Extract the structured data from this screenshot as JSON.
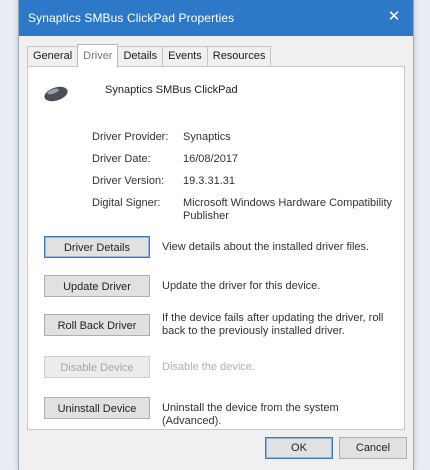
{
  "window": {
    "title": "Synaptics SMBus ClickPad Properties",
    "close_glyph": "✕",
    "titlebar_color": "#2d79c7"
  },
  "tabs": [
    {
      "label": "General"
    },
    {
      "label": "Driver",
      "active": true
    },
    {
      "label": "Details"
    },
    {
      "label": "Events"
    },
    {
      "label": "Resources"
    }
  ],
  "device": {
    "icon": "touchpad-mouse-icon",
    "name": "Synaptics SMBus ClickPad"
  },
  "properties": {
    "provider_label": "Driver Provider:",
    "provider_value": "Synaptics",
    "date_label": "Driver Date:",
    "date_value": "16/08/2017",
    "version_label": "Driver Version:",
    "version_value": "19.3.31.31",
    "signer_label": "Digital Signer:",
    "signer_value": "Microsoft Windows Hardware Compatibility Publisher"
  },
  "actions": {
    "details": {
      "label": "Driver Details",
      "desc": "View details about the installed driver files."
    },
    "update": {
      "label": "Update Driver",
      "desc": "Update the driver for this device."
    },
    "rollback": {
      "label": "Roll Back Driver",
      "desc": "If the device fails after updating the driver, roll back to the previously installed driver."
    },
    "disable": {
      "label": "Disable Device",
      "desc": "Disable the device."
    },
    "uninstall": {
      "label": "Uninstall Device",
      "desc": "Uninstall the device from the system (Advanced)."
    }
  },
  "footer": {
    "ok_label": "OK",
    "cancel_label": "Cancel"
  }
}
